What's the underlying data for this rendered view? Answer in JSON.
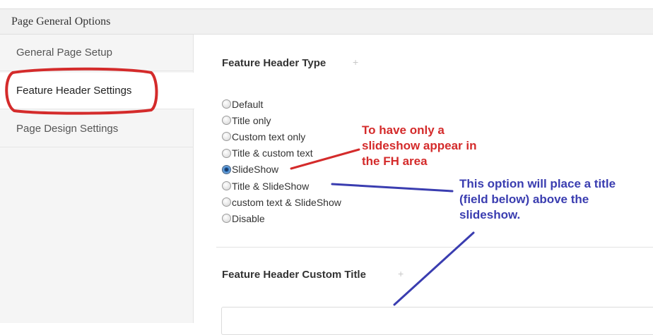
{
  "panel": {
    "title": "Page General Options"
  },
  "sidebar": {
    "items": [
      {
        "label": "General Page Setup"
      },
      {
        "label": "Feature Header Settings"
      },
      {
        "label": "Page Design Settings"
      }
    ]
  },
  "feature_header_type": {
    "title": "Feature Header Type",
    "plus_icon": "+",
    "options": [
      {
        "label": "Default",
        "checked": false
      },
      {
        "label": "Title only",
        "checked": false
      },
      {
        "label": "Custom text only",
        "checked": false
      },
      {
        "label": "Title & custom text",
        "checked": false
      },
      {
        "label": "SlideShow",
        "checked": true
      },
      {
        "label": "Title & SlideShow",
        "checked": false
      },
      {
        "label": "custom text & SlideShow",
        "checked": false
      },
      {
        "label": "Disable",
        "checked": false
      }
    ]
  },
  "custom_title": {
    "title": "Feature Header Custom Title",
    "plus_icon": "+",
    "value": ""
  },
  "annotations": {
    "red_note": [
      "To have only a",
      "slideshow appear in",
      "the FH area"
    ],
    "blue_note": [
      "This option will place a title",
      "(field below) above the",
      "slideshow."
    ],
    "red_color": "#d42b2b",
    "blue_color": "#3a3db0"
  }
}
